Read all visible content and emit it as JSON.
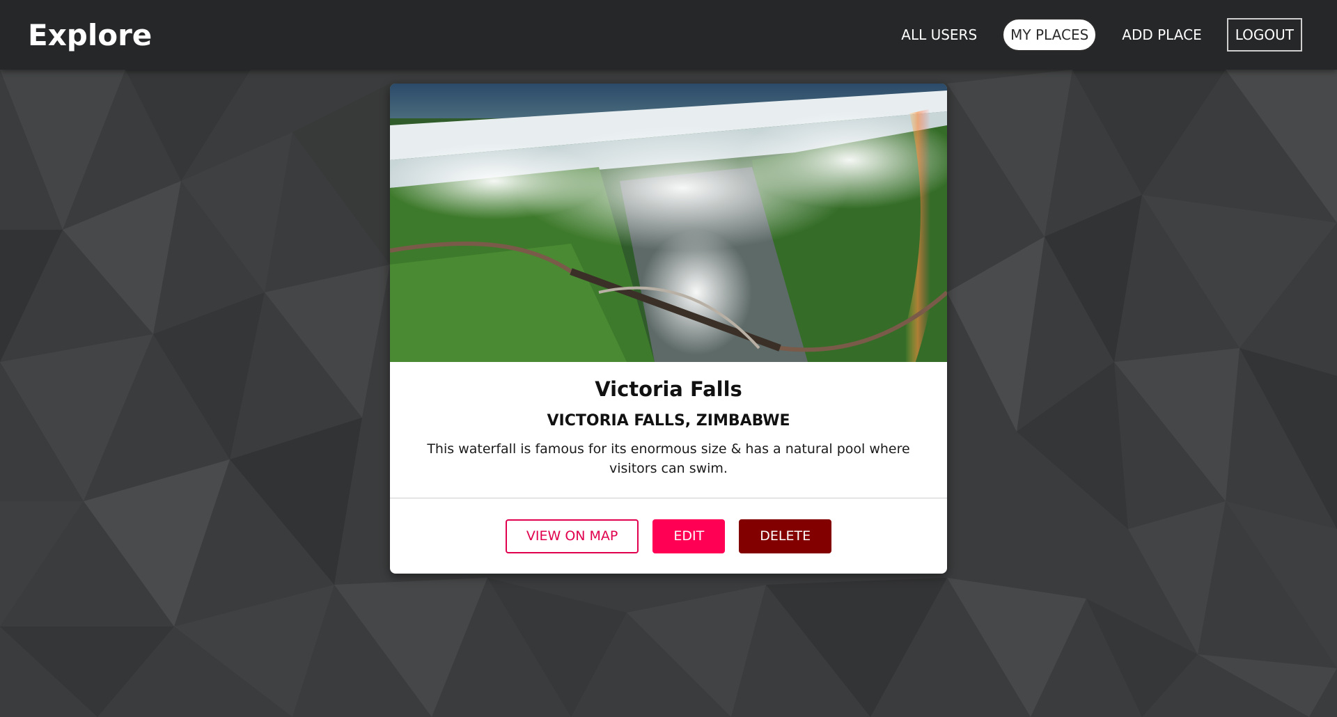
{
  "app": {
    "brand": "Explore"
  },
  "nav": {
    "items": [
      {
        "label": "ALL USERS",
        "active": false
      },
      {
        "label": "MY PLACES",
        "active": true
      },
      {
        "label": "ADD PLACE",
        "active": false
      },
      {
        "label": "LOGOUT",
        "active": false
      }
    ]
  },
  "place": {
    "title": "Victoria Falls",
    "address": "VICTORIA FALLS, ZIMBABWE",
    "description": "This waterfall is famous for its enormous size & has a natural pool where visitors can swim.",
    "image_icon": "waterfall-photo"
  },
  "actions": {
    "view_on_map": "VIEW ON MAP",
    "edit": "EDIT",
    "delete": "DELETE"
  },
  "colors": {
    "navbar": "#262728",
    "accent_pink": "#ff0055",
    "delete_red": "#830000"
  }
}
